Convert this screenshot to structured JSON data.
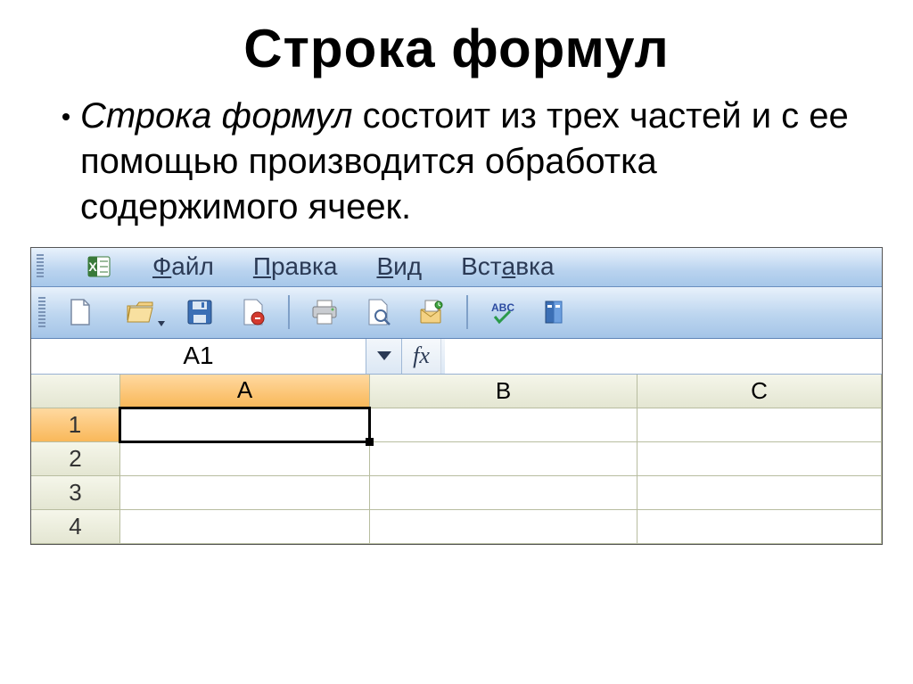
{
  "title": "Строка  формул",
  "bullet": {
    "lead": "Строка формул",
    "rest": " состоит из трех частей и с ее помощью производится обработка содержимого ячеек."
  },
  "menus": {
    "file": {
      "accel": "Ф",
      "rest": "айл"
    },
    "edit": {
      "accel": "П",
      "rest": "равка"
    },
    "view": {
      "accel": "В",
      "rest": "ид"
    },
    "insert_pre": "Вст",
    "insert_accel": "а",
    "insert_post": "вка"
  },
  "formula_bar": {
    "namebox": "A1",
    "fx": "fx",
    "value": ""
  },
  "columns": [
    "A",
    "B",
    "C"
  ],
  "rows": [
    "1",
    "2",
    "3",
    "4"
  ],
  "selected_col": 0,
  "selected_row": 0
}
